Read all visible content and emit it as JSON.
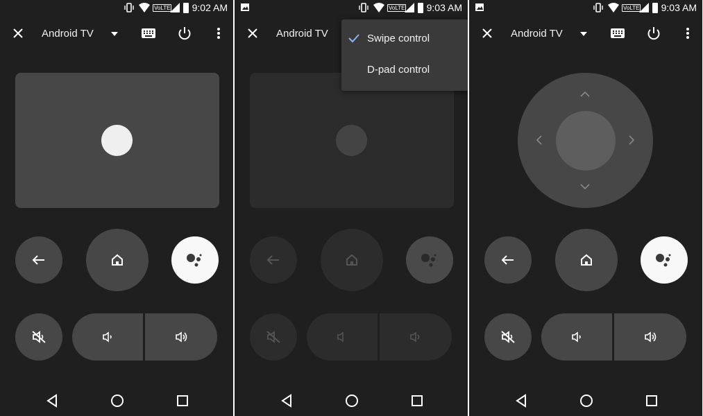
{
  "panels": [
    {
      "time": "9:02 AM",
      "title": "Android TV"
    },
    {
      "time": "9:03 AM",
      "title": "Android TV"
    },
    {
      "time": "9:03 AM",
      "title": "Android TV"
    }
  ],
  "status": {
    "volte": "VoLTE"
  },
  "menu": {
    "items": [
      "Swipe control",
      "D-pad control"
    ],
    "selected": "Swipe control"
  },
  "icons": {
    "close": "close-icon",
    "dropdown": "dropdown-arrow-icon",
    "keyboard": "keyboard-icon",
    "power": "power-icon",
    "more": "more-vert-icon",
    "back": "back-arrow-icon",
    "home": "home-icon",
    "assistant": "google-assistant-icon",
    "mute": "mute-icon",
    "volume_down": "volume-down-icon",
    "volume_up": "volume-up-icon"
  },
  "colors": {
    "background": "#1f1f1f",
    "control": "#474747",
    "accent_check": "#8ab4f8",
    "assistant_bg": "#f8f8f8"
  }
}
